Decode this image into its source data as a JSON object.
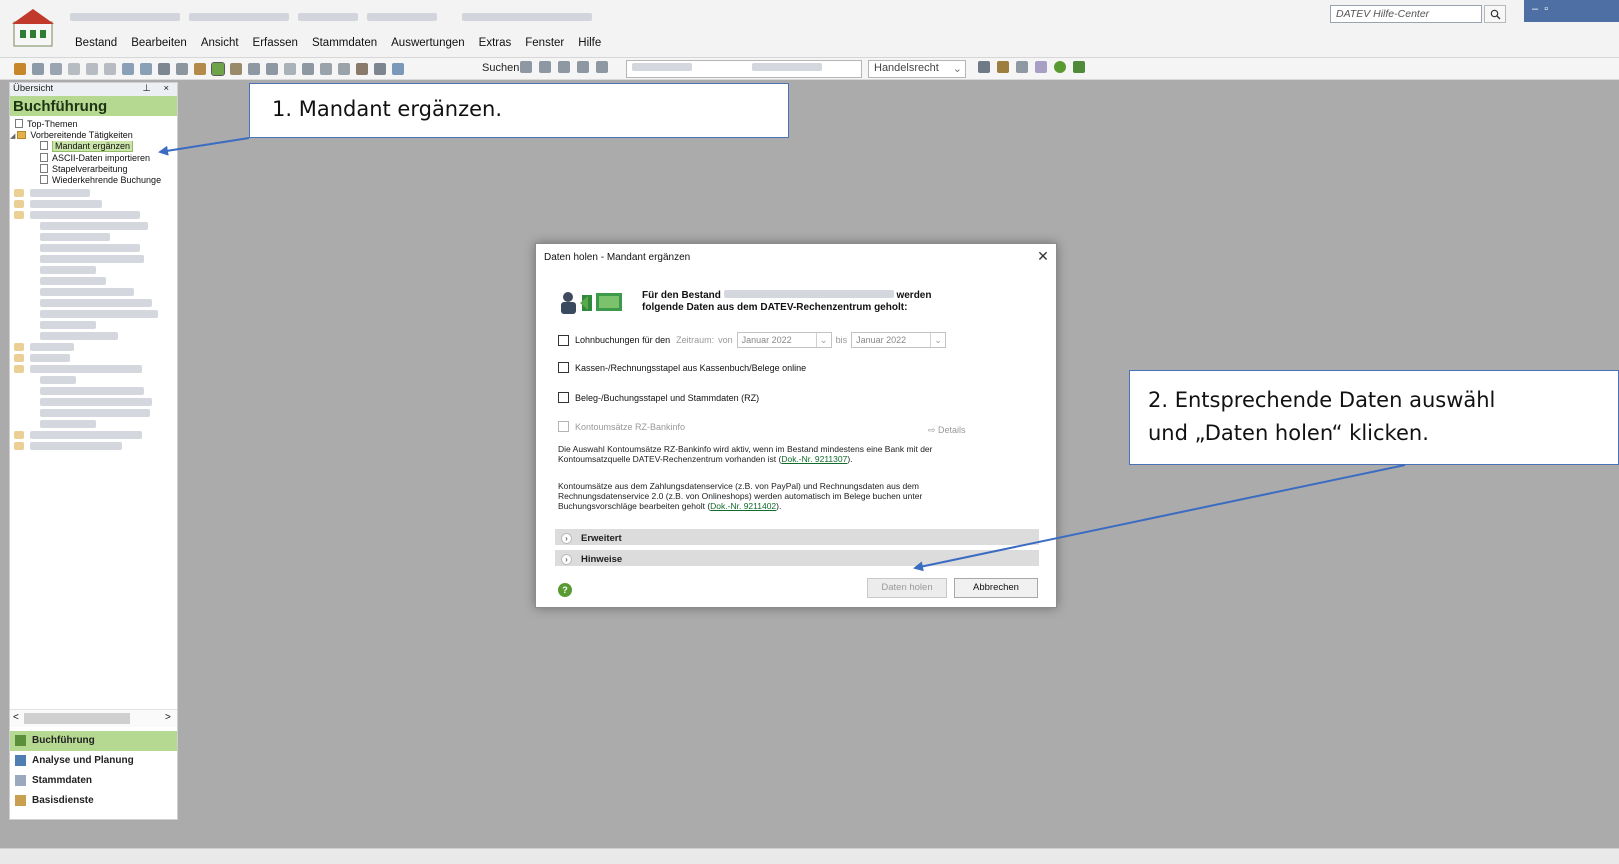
{
  "app": {
    "menu": [
      "Bestand",
      "Bearbeiten",
      "Ansicht",
      "Erfassen",
      "Stammdaten",
      "Auswertungen",
      "Extras",
      "Fenster",
      "Hilfe"
    ],
    "help_center_placeholder": "DATEV Hilfe-Center"
  },
  "toolbar": {
    "search_label": "Suchen",
    "law_select": "Handelsrecht"
  },
  "sidebar": {
    "header": "Übersicht",
    "pin": "⊥",
    "close": "×",
    "title": "Buchführung",
    "tree": [
      {
        "label": "Top-Themen",
        "type": "doc",
        "indent": 1
      },
      {
        "label": "Vorbereitende Tätigkeiten",
        "type": "folder",
        "indent": 0
      },
      {
        "label": "Mandant ergänzen",
        "type": "doc",
        "indent": 2,
        "selected": true
      },
      {
        "label": "ASCII-Daten importieren",
        "type": "doc",
        "indent": 2
      },
      {
        "label": "Stapelverarbeitung",
        "type": "doc",
        "indent": 2
      },
      {
        "label": "Wiederkehrende Buchunge",
        "type": "doc",
        "indent": 2
      }
    ],
    "scroll_left": "<",
    "scroll_right": ">",
    "nav": [
      "Buchführung",
      "Analyse und Planung",
      "Stammdaten",
      "Basisdienste"
    ]
  },
  "callouts": {
    "step1": "1. Mandant ergänzen.",
    "step2_line1": "2. Entsprechende Daten auswähl",
    "step2_line2": "und „Daten holen“ klicken."
  },
  "dialog": {
    "title": "Daten holen - Mandant ergänzen",
    "close": "✕",
    "head_part1": "Für den Bestand",
    "head_part2": "werden",
    "head_line2": "folgende Daten aus dem DATEV-Rechenzentrum geholt:",
    "lohn_label": "Lohnbuchungen für den",
    "zeitraum": "Zeitraum:",
    "von": "von",
    "from_month": "Januar 2022",
    "bis": "bis",
    "to_month": "Januar 2022",
    "kassen_label": "Kassen-/Rechnungsstapel aus Kassenbuch/Belege online",
    "beleg_label": "Beleg-/Buchungsstapel und Stammdaten (RZ)",
    "konto_label": "Kontoumsätze RZ-Bankinfo",
    "details": "⇨ Details",
    "info1_text": "Die Auswahl Kontoumsätze RZ-Bankinfo wird aktiv, wenn im Bestand mindestens eine Bank mit der Kontoumsatzquelle DATEV-Rechenzentrum vorhanden ist (",
    "info1_link": "Dok.-Nr. 9211307",
    "info1_end": ").",
    "info2_text": "Kontoumsätze aus dem Zahlungsdatenservice (z.B. von PayPal) und Rechnungsdaten aus dem Rechnungsdatenservice 2.0 (z.B. von Onlineshops) werden automatisch im Belege buchen unter Buchungsvorschläge bearbeiten geholt (",
    "info2_link": "Dok.-Nr. 9211402",
    "info2_end": ").",
    "section1": "Erweitert",
    "section2": "Hinweise",
    "help": "?",
    "ok": "Daten holen",
    "cancel": "Abbrechen"
  },
  "colors": {
    "accent_green": "#b6d991",
    "callout_border": "#4a72b9",
    "arrow": "#3b6cc2"
  }
}
